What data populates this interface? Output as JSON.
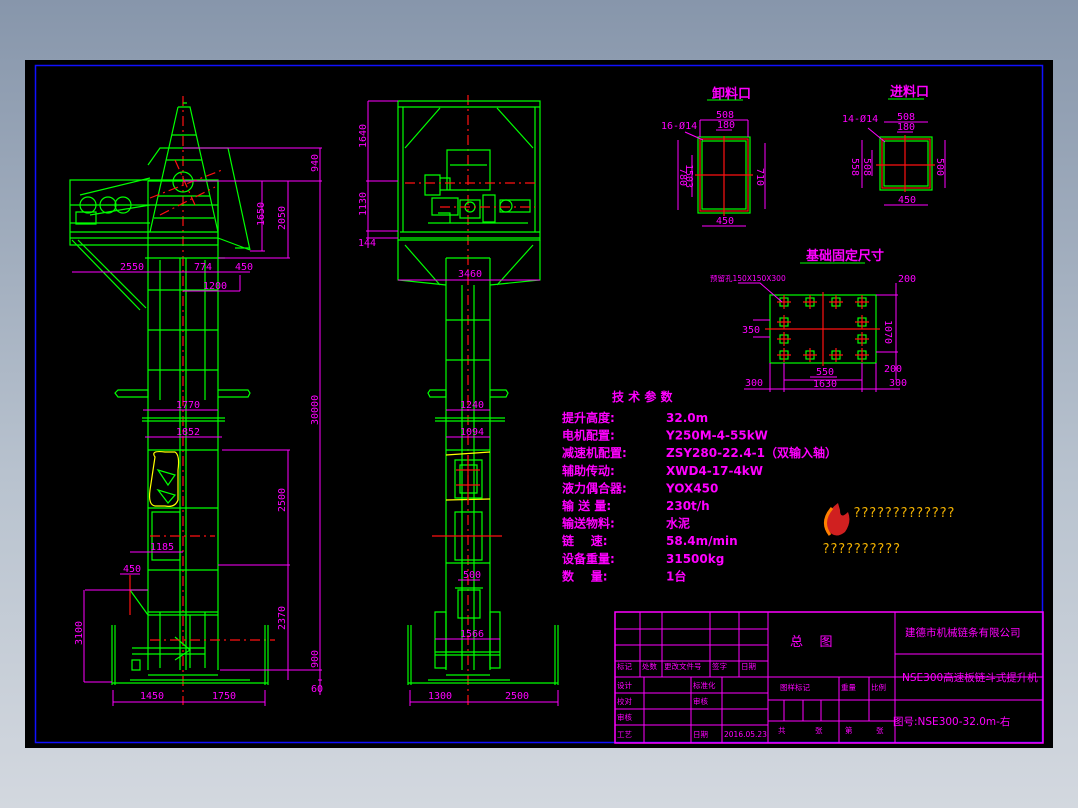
{
  "colors": {
    "background": "#000000",
    "frame": "#0000ff",
    "geometry": "#00ff00",
    "centerline": "#ff1010",
    "annotation": "#ff00ff",
    "hidden": "#ffff00"
  },
  "left_view": {
    "dims": {
      "d2550": "2550",
      "d774": "774",
      "d450a": "450",
      "d1200": "1200",
      "d940": "940",
      "d1650": "1650",
      "d2050": "2050",
      "d30000": "30000",
      "d1770": "1770",
      "d1852": "1852",
      "d2500": "2500",
      "d2370": "2370",
      "d900": "900",
      "d60": "60",
      "d3100": "3100",
      "d450b": "450",
      "d1185": "1185",
      "d1450": "1450",
      "d1750": "1750"
    }
  },
  "front_view": {
    "dims": {
      "d1640": "1640",
      "d1130": "1130",
      "d144": "144",
      "d3460": "3460",
      "d1240": "1240",
      "d1094": "1094",
      "d500": "500",
      "d1566": "1566",
      "d1300": "1300",
      "d2500": "2500"
    }
  },
  "outlet": {
    "title": "卸料口",
    "holes": "16-Ø14",
    "w1": "508",
    "w2": "180",
    "h1": "780",
    "h2": "1503",
    "h3": "710",
    "w3": "450"
  },
  "inlet": {
    "title": "进料口",
    "holes": "14-Ø14",
    "w1": "508",
    "w2": "180",
    "h1": "558",
    "h2": "508",
    "h3": "500",
    "w3": "450"
  },
  "foundation": {
    "title": "基础固定尺寸",
    "note": "预留孔150X150X300",
    "d200a": "200",
    "d1070": "1070",
    "d350": "350",
    "d550": "550",
    "d1630": "1630",
    "d300a": "300",
    "d300b": "300",
    "d200b": "200"
  },
  "params": {
    "title": "技 术 参 数",
    "rows": [
      {
        "label": "提升高度:",
        "value": "32.0m"
      },
      {
        "label": "电机配置:",
        "value": "Y250M-4-55kW"
      },
      {
        "label": "减速机配置:",
        "value": "ZSY280-22.4-1（双输入轴）"
      },
      {
        "label": "辅助传动:",
        "value": "XWD4-17-4kW"
      },
      {
        "label": "液力偶合器:",
        "value": "YOX450"
      },
      {
        "label": "输 送 量:",
        "value": "230t/h"
      },
      {
        "label": "输送物料:",
        "value": "水泥"
      },
      {
        "label": "链    速:",
        "value": "58.4m/min"
      },
      {
        "label": "设备重量:",
        "value": "31500kg"
      },
      {
        "label": "数    量:",
        "value": "1台"
      }
    ]
  },
  "logo": {
    "line1": "?????????????",
    "line2": "??????????"
  },
  "title_block": {
    "drawing_name": "总    图",
    "company": "建德市机械链条有限公司",
    "product": "NSE300高速板链斗式提升机",
    "drawing_no": "图号:NSE300-32.0m-右",
    "rev_headers": [
      "标记",
      "处数",
      "更改文件号",
      "签字",
      "日期"
    ],
    "designer": "设计",
    "standardize": "标准化",
    "checker": "校对",
    "reviewer": "审核",
    "approver": "审核",
    "process": "工艺",
    "date_label": "日期",
    "date": "2016.05.23",
    "sample_mark": "图样标记",
    "weight": "重量",
    "scale": "比例",
    "total": "共",
    "sheet": "张",
    "nth": "第",
    "sheet2": "张"
  }
}
